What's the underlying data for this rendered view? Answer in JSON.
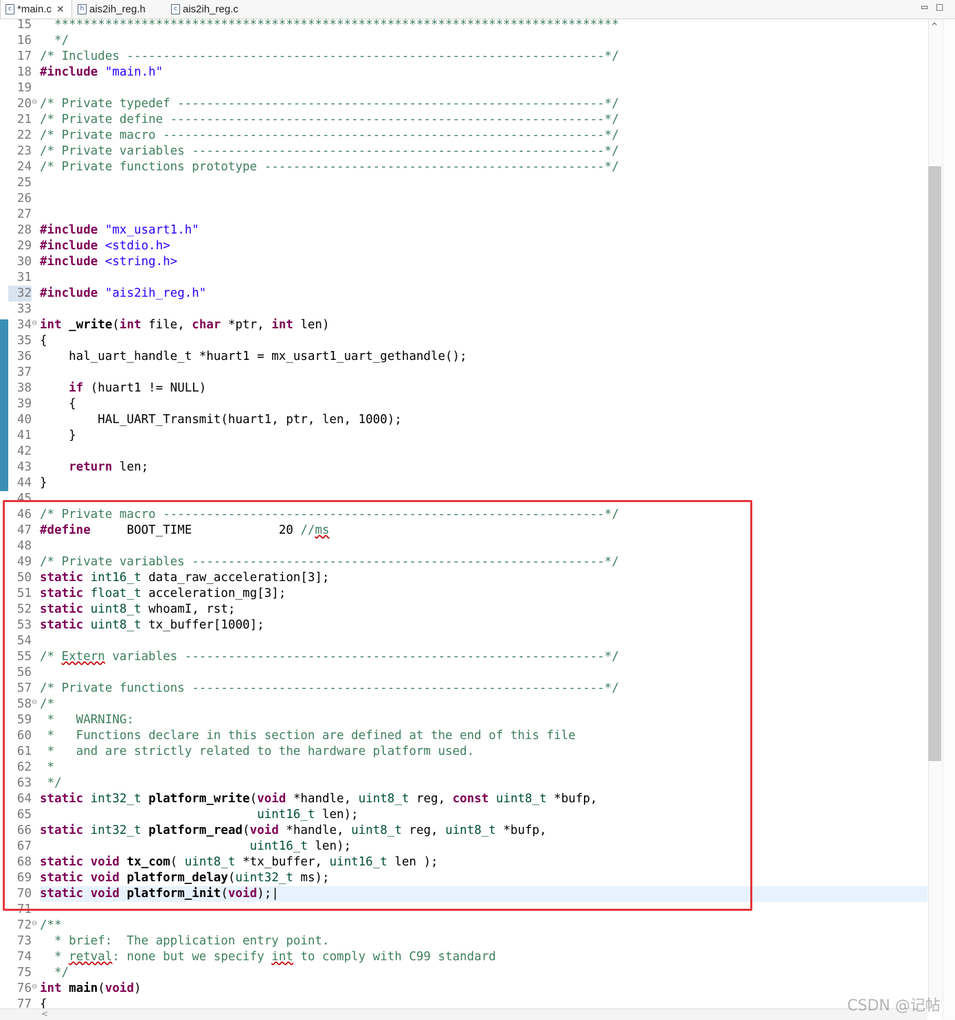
{
  "tabs": [
    {
      "label": "*main.c",
      "icon": "c-source-file-icon",
      "active": true,
      "closable": true
    },
    {
      "label": "ais2ih_reg.h",
      "icon": "c-header-file-icon",
      "active": false
    },
    {
      "label": "ais2ih_reg.c",
      "icon": "c-source-file-icon",
      "active": false
    }
  ],
  "window_controls": {
    "minimize": "▭",
    "maximize": "□"
  },
  "editor": {
    "current_line": 70,
    "lines": [
      {
        "n": "15",
        "t": [
          [
            "cm",
            "  ******************************************************************************"
          ]
        ]
      },
      {
        "n": "16",
        "t": [
          [
            "cm",
            "  */"
          ]
        ]
      },
      {
        "n": "17",
        "t": [
          [
            "cm",
            "/* Includes ------------------------------------------------------------------*/"
          ]
        ]
      },
      {
        "n": "18",
        "t": [
          [
            "kw",
            "#include"
          ],
          [
            "",
            " "
          ],
          [
            "st",
            "\"main.h\""
          ]
        ]
      },
      {
        "n": "19",
        "t": []
      },
      {
        "n": "20",
        "fold": true,
        "t": [
          [
            "cm",
            "/* Private typedef -----------------------------------------------------------*/"
          ]
        ]
      },
      {
        "n": "21",
        "t": [
          [
            "cm",
            "/* Private define ------------------------------------------------------------*/"
          ]
        ]
      },
      {
        "n": "22",
        "t": [
          [
            "cm",
            "/* Private macro -------------------------------------------------------------*/"
          ]
        ]
      },
      {
        "n": "23",
        "t": [
          [
            "cm",
            "/* Private variables ---------------------------------------------------------*/"
          ]
        ]
      },
      {
        "n": "24",
        "t": [
          [
            "cm",
            "/* Private functions prototype -----------------------------------------------*/"
          ]
        ]
      },
      {
        "n": "25",
        "t": []
      },
      {
        "n": "26",
        "t": []
      },
      {
        "n": "27",
        "t": []
      },
      {
        "n": "28",
        "t": [
          [
            "kw",
            "#include"
          ],
          [
            "",
            " "
          ],
          [
            "st",
            "\"mx_usart1.h\""
          ]
        ]
      },
      {
        "n": "29",
        "t": [
          [
            "kw",
            "#include"
          ],
          [
            "",
            " "
          ],
          [
            "st",
            "<stdio.h>"
          ]
        ]
      },
      {
        "n": "30",
        "t": [
          [
            "kw",
            "#include"
          ],
          [
            "",
            " "
          ],
          [
            "st",
            "<string.h>"
          ]
        ]
      },
      {
        "n": "31",
        "t": []
      },
      {
        "n": "32",
        "hl": true,
        "t": [
          [
            "kw",
            "#include"
          ],
          [
            "",
            " "
          ],
          [
            "st",
            "\"ais2ih_reg.h\""
          ]
        ]
      },
      {
        "n": "33",
        "t": []
      },
      {
        "n": "34",
        "fold": true,
        "t": [
          [
            "kw",
            "int"
          ],
          [
            "",
            " "
          ],
          [
            "fn",
            "_write"
          ],
          [
            "",
            "("
          ],
          [
            "kw",
            "int"
          ],
          [
            "",
            " file, "
          ],
          [
            "kw",
            "char"
          ],
          [
            "",
            " *ptr, "
          ],
          [
            "kw",
            "int"
          ],
          [
            "",
            " len)"
          ]
        ]
      },
      {
        "n": "35",
        "t": [
          [
            "",
            "{"
          ]
        ]
      },
      {
        "n": "36",
        "t": [
          [
            "",
            "    hal_uart_handle_t *huart1 = mx_usart1_uart_gethandle();"
          ]
        ]
      },
      {
        "n": "37",
        "t": []
      },
      {
        "n": "38",
        "t": [
          [
            "",
            "    "
          ],
          [
            "kw",
            "if"
          ],
          [
            "",
            " (huart1 != NULL)"
          ]
        ]
      },
      {
        "n": "39",
        "t": [
          [
            "",
            "    {"
          ]
        ]
      },
      {
        "n": "40",
        "t": [
          [
            "",
            "        HAL_UART_Transmit(huart1, ptr, len, 1000);"
          ]
        ]
      },
      {
        "n": "41",
        "t": [
          [
            "",
            "    }"
          ]
        ]
      },
      {
        "n": "42",
        "t": []
      },
      {
        "n": "43",
        "t": [
          [
            "",
            "    "
          ],
          [
            "kw",
            "return"
          ],
          [
            "",
            " len;"
          ]
        ]
      },
      {
        "n": "44",
        "t": [
          [
            "",
            "}"
          ]
        ]
      },
      {
        "n": "45",
        "t": []
      },
      {
        "n": "46",
        "t": [
          [
            "cm",
            "/* Private macro -------------------------------------------------------------*/"
          ]
        ]
      },
      {
        "n": "47",
        "t": [
          [
            "kw",
            "#define"
          ],
          [
            "",
            "     BOOT_TIME            20 "
          ],
          [
            "cm",
            "//"
          ],
          [
            "cmsq",
            "ms"
          ]
        ]
      },
      {
        "n": "48",
        "t": []
      },
      {
        "n": "49",
        "t": [
          [
            "cm",
            "/* Private variables ---------------------------------------------------------*/"
          ]
        ]
      },
      {
        "n": "50",
        "t": [
          [
            "kw",
            "static"
          ],
          [
            "",
            " "
          ],
          [
            "ty",
            "int16_t"
          ],
          [
            "",
            " data_raw_acceleration[3];"
          ]
        ]
      },
      {
        "n": "51",
        "t": [
          [
            "kw",
            "static"
          ],
          [
            "",
            " "
          ],
          [
            "ty",
            "float_t"
          ],
          [
            "",
            " acceleration_mg[3];"
          ]
        ]
      },
      {
        "n": "52",
        "t": [
          [
            "kw",
            "static"
          ],
          [
            "",
            " "
          ],
          [
            "ty",
            "uint8_t"
          ],
          [
            "",
            " whoamI, rst;"
          ]
        ]
      },
      {
        "n": "53",
        "t": [
          [
            "kw",
            "static"
          ],
          [
            "",
            " "
          ],
          [
            "ty",
            "uint8_t"
          ],
          [
            "",
            " tx_buffer[1000];"
          ]
        ]
      },
      {
        "n": "54",
        "t": []
      },
      {
        "n": "55",
        "t": [
          [
            "cm",
            "/* "
          ],
          [
            "cmsq",
            "Extern"
          ],
          [
            "cm",
            " variables ----------------------------------------------------------*/"
          ]
        ]
      },
      {
        "n": "56",
        "t": []
      },
      {
        "n": "57",
        "t": [
          [
            "cm",
            "/* Private functions ---------------------------------------------------------*/"
          ]
        ]
      },
      {
        "n": "58",
        "fold": true,
        "t": [
          [
            "cm",
            "/*"
          ]
        ]
      },
      {
        "n": "59",
        "t": [
          [
            "cm",
            " *   WARNING:"
          ]
        ]
      },
      {
        "n": "60",
        "t": [
          [
            "cm",
            " *   Functions declare in this section are defined at the end of this file"
          ]
        ]
      },
      {
        "n": "61",
        "t": [
          [
            "cm",
            " *   and are strictly related to the hardware platform used."
          ]
        ]
      },
      {
        "n": "62",
        "t": [
          [
            "cm",
            " *"
          ]
        ]
      },
      {
        "n": "63",
        "t": [
          [
            "cm",
            " */"
          ]
        ]
      },
      {
        "n": "64",
        "t": [
          [
            "kw",
            "static"
          ],
          [
            "",
            " "
          ],
          [
            "ty",
            "int32_t"
          ],
          [
            "",
            " "
          ],
          [
            "fn",
            "platform_write"
          ],
          [
            "",
            "("
          ],
          [
            "kw",
            "void"
          ],
          [
            "",
            " *handle, "
          ],
          [
            "ty",
            "uint8_t"
          ],
          [
            "",
            " reg, "
          ],
          [
            "kw",
            "const"
          ],
          [
            "",
            " "
          ],
          [
            "ty",
            "uint8_t"
          ],
          [
            "",
            " *bufp,"
          ]
        ]
      },
      {
        "n": "65",
        "t": [
          [
            "",
            "                              "
          ],
          [
            "ty",
            "uint16_t"
          ],
          [
            "",
            " len);"
          ]
        ]
      },
      {
        "n": "66",
        "t": [
          [
            "kw",
            "static"
          ],
          [
            "",
            " "
          ],
          [
            "ty",
            "int32_t"
          ],
          [
            "",
            " "
          ],
          [
            "fn",
            "platform_read"
          ],
          [
            "",
            "("
          ],
          [
            "kw",
            "void"
          ],
          [
            "",
            " *handle, "
          ],
          [
            "ty",
            "uint8_t"
          ],
          [
            "",
            " reg, "
          ],
          [
            "ty",
            "uint8_t"
          ],
          [
            "",
            " *bufp,"
          ]
        ]
      },
      {
        "n": "67",
        "t": [
          [
            "",
            "                             "
          ],
          [
            "ty",
            "uint16_t"
          ],
          [
            "",
            " len);"
          ]
        ]
      },
      {
        "n": "68",
        "t": [
          [
            "kw",
            "static"
          ],
          [
            "",
            " "
          ],
          [
            "kw",
            "void"
          ],
          [
            "",
            " "
          ],
          [
            "fn",
            "tx_com"
          ],
          [
            "",
            "( "
          ],
          [
            "ty",
            "uint8_t"
          ],
          [
            "",
            " *tx_buffer, "
          ],
          [
            "ty",
            "uint16_t"
          ],
          [
            "",
            " len );"
          ]
        ]
      },
      {
        "n": "69",
        "t": [
          [
            "kw",
            "static"
          ],
          [
            "",
            " "
          ],
          [
            "kw",
            "void"
          ],
          [
            "",
            " "
          ],
          [
            "fn",
            "platform_delay"
          ],
          [
            "",
            "("
          ],
          [
            "ty",
            "uint32_t"
          ],
          [
            "",
            " ms);"
          ]
        ]
      },
      {
        "n": "70",
        "t": [
          [
            "kw",
            "static"
          ],
          [
            "",
            " "
          ],
          [
            "kw",
            "void"
          ],
          [
            "",
            " "
          ],
          [
            "fn",
            "platform_init"
          ],
          [
            "",
            "("
          ],
          [
            "kw",
            "void"
          ],
          [
            "",
            ");|"
          ]
        ]
      },
      {
        "n": "71",
        "t": []
      },
      {
        "n": "72",
        "fold": true,
        "t": [
          [
            "cm",
            "/**"
          ]
        ]
      },
      {
        "n": "73",
        "t": [
          [
            "cm",
            "  * brief:  The application entry point."
          ]
        ]
      },
      {
        "n": "74",
        "t": [
          [
            "cm",
            "  * "
          ],
          [
            "cmsq",
            "retval"
          ],
          [
            "cm",
            ": none but we specify "
          ],
          [
            "cmsq",
            "int"
          ],
          [
            "cm",
            " to comply with C99 standard"
          ]
        ]
      },
      {
        "n": "75",
        "t": [
          [
            "cm",
            "  */"
          ]
        ]
      },
      {
        "n": "76",
        "fold": true,
        "t": [
          [
            "kw",
            "int"
          ],
          [
            "",
            " "
          ],
          [
            "fn",
            "main"
          ],
          [
            "",
            "("
          ],
          [
            "kw",
            "void"
          ],
          [
            "",
            ")"
          ]
        ]
      },
      {
        "n": "77",
        "t": [
          [
            "",
            "{"
          ]
        ]
      }
    ]
  },
  "watermark": "CSDN @记帖"
}
